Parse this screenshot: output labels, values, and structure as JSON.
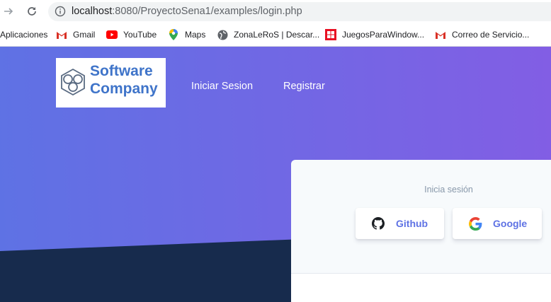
{
  "browser": {
    "url_host": "localhost",
    "url_rest": ":8080/ProyectoSena1/examples/login.php"
  },
  "bookmarks": [
    {
      "label": "Aplicaciones",
      "icon": "apps-icon"
    },
    {
      "label": "Gmail",
      "icon": "gmail-icon"
    },
    {
      "label": "YouTube",
      "icon": "youtube-icon"
    },
    {
      "label": "Maps",
      "icon": "maps-icon"
    },
    {
      "label": "ZonaLeRoS | Descar...",
      "icon": "globe-icon"
    },
    {
      "label": "JuegosParaWindow...",
      "icon": "windows-icon"
    },
    {
      "label": "Correo de Servicio...",
      "icon": "gmail-icon"
    }
  ],
  "navbar": {
    "logo_line1": "Software",
    "logo_line2": "Company",
    "links": [
      "Iniciar Sesion",
      "Registrar"
    ]
  },
  "login_card": {
    "subtitle": "Inicia sesión",
    "buttons": [
      {
        "label": "Github",
        "icon": "github-icon"
      },
      {
        "label": "Google",
        "icon": "google-icon"
      }
    ]
  },
  "colors": {
    "gradient_start": "#5e72e4",
    "gradient_end": "#825ee4",
    "dark_section": "#172b4d",
    "button_text": "#5e72e4"
  }
}
